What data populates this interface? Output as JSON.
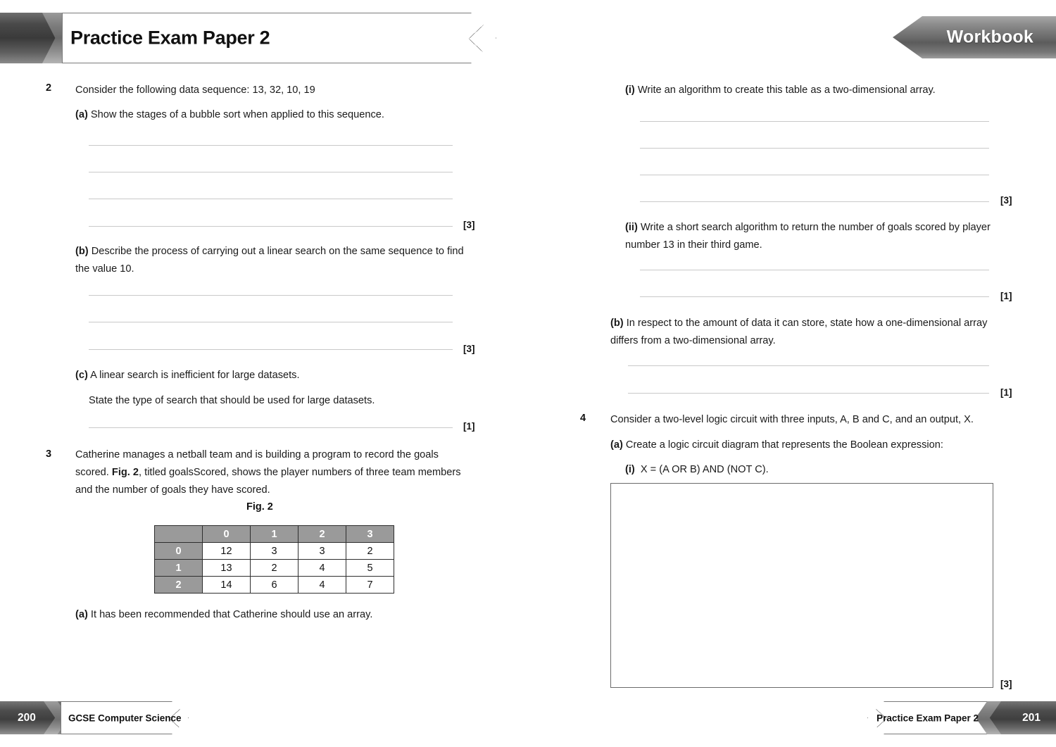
{
  "header": {
    "title": "Practice Exam Paper 2",
    "badge": "Workbook"
  },
  "left_page": {
    "questions": [
      {
        "number": "2",
        "stem": "Consider the following data sequence: 13, 32, 10, 19",
        "parts": [
          {
            "label": "(a)",
            "text": "Show the stages of a bubble sort when applied to this sequence.",
            "marks": "[3]",
            "lines": 4
          },
          {
            "label": "(b)",
            "text": "Describe the process of carrying out a linear search on the same sequence to find the value 10.",
            "marks": "[3]",
            "lines": 3
          },
          {
            "label": "(c)",
            "text": "A linear search is inefficient for large datasets.",
            "text2": "State the type of search that should be used for large datasets.",
            "marks": "[1]",
            "lines": 1
          }
        ]
      },
      {
        "number": "3",
        "stem_pre": "Catherine manages a netball team and is building a program to record the goals scored. ",
        "stem_bold": "Fig. 2",
        "stem_post": ", titled goalsScored, shows the player numbers of three team members and the number of goals they have scored.",
        "figure_caption": "Fig. 2",
        "parts": [
          {
            "label": "(a)",
            "text": "It has been recommended that Catherine should use an array."
          }
        ]
      }
    ]
  },
  "chart_data": {
    "type": "table",
    "title": "Fig. 2",
    "name": "goalsScored",
    "column_headers": [
      "",
      "0",
      "1",
      "2",
      "3"
    ],
    "row_headers": [
      "0",
      "1",
      "2"
    ],
    "rows": [
      [
        "0",
        "12",
        "3",
        "3",
        "2"
      ],
      [
        "1",
        "13",
        "2",
        "4",
        "5"
      ],
      [
        "2",
        "14",
        "6",
        "4",
        "7"
      ]
    ]
  },
  "right_page": {
    "q3_continued": [
      {
        "label": "(i)",
        "text": "Write an algorithm to create this table as a two-dimensional array.",
        "marks": "[3]",
        "lines": 4
      },
      {
        "label": "(ii)",
        "text": "Write a short search algorithm to return the number of goals scored by player number 13 in their third game.",
        "marks": "[1]",
        "lines": 2
      },
      {
        "label": "(b)",
        "text": "In respect to the amount of data it can store, state how a one-dimensional array differs from a two-dimensional array.",
        "marks": "[1]",
        "lines": 2
      }
    ],
    "question4": {
      "number": "4",
      "stem": "Consider a two-level logic circuit with three inputs, A, B and C, and an output, X.",
      "part_a_label": "(a)",
      "part_a_text": "Create a logic circuit diagram that represents the Boolean expression:",
      "sub_label": "(i)",
      "sub_text": "X = (A OR B) AND (NOT C).",
      "marks": "[3]"
    }
  },
  "footer": {
    "left_page_number": "200",
    "left_text": "GCSE Computer Science",
    "right_text": "Practice Exam Paper 2",
    "right_page_number": "201"
  },
  "colors": {
    "table_header_gray": "#9a9a9a",
    "rule_gray": "#c9c9c9",
    "banner_dark": "#4d4d4d"
  }
}
